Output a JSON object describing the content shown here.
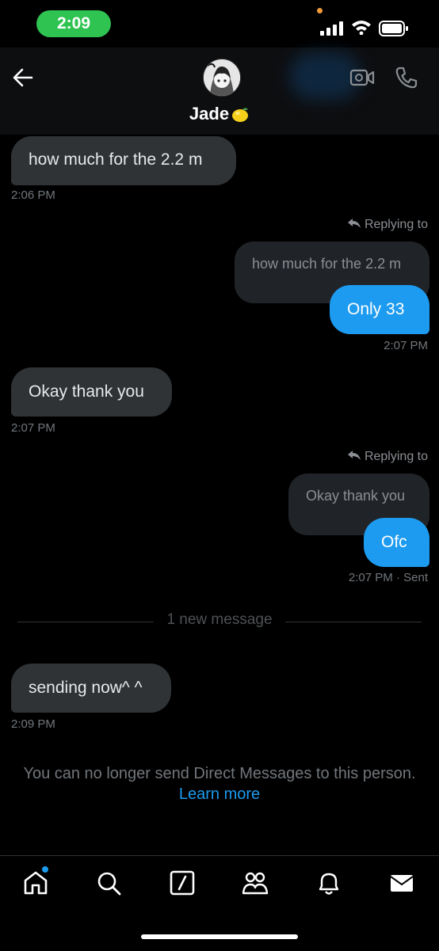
{
  "status_bar": {
    "time": "2:09"
  },
  "header": {
    "name": "Jade"
  },
  "messages": [
    {
      "text": "how much for the 2.2 m",
      "time": "2:06 PM"
    },
    {
      "reply_label": "Replying to",
      "quoted": "how much for the 2.2 m",
      "text": "Only 33",
      "time": "2:07 PM"
    },
    {
      "text": "Okay thank you",
      "time": "2:07 PM"
    },
    {
      "reply_label": "Replying to",
      "quoted": "Okay thank you",
      "text": "Ofc",
      "time": "2:07 PM",
      "status": "· Sent"
    },
    {
      "text": "sending now^ ^",
      "time": "2:09 PM"
    }
  ],
  "new_message_divider": "1 new message",
  "notice": {
    "text": "You can no longer send Direct Messages to this person.",
    "link": "Learn more"
  },
  "tabs": [
    "home-icon",
    "search-icon",
    "grok-icon",
    "communities-icon",
    "notifications-icon",
    "messages-icon"
  ],
  "colors": {
    "accent": "#1d9bf0",
    "status_pill": "#2fc352",
    "incoming_bubble": "#2f3336"
  }
}
